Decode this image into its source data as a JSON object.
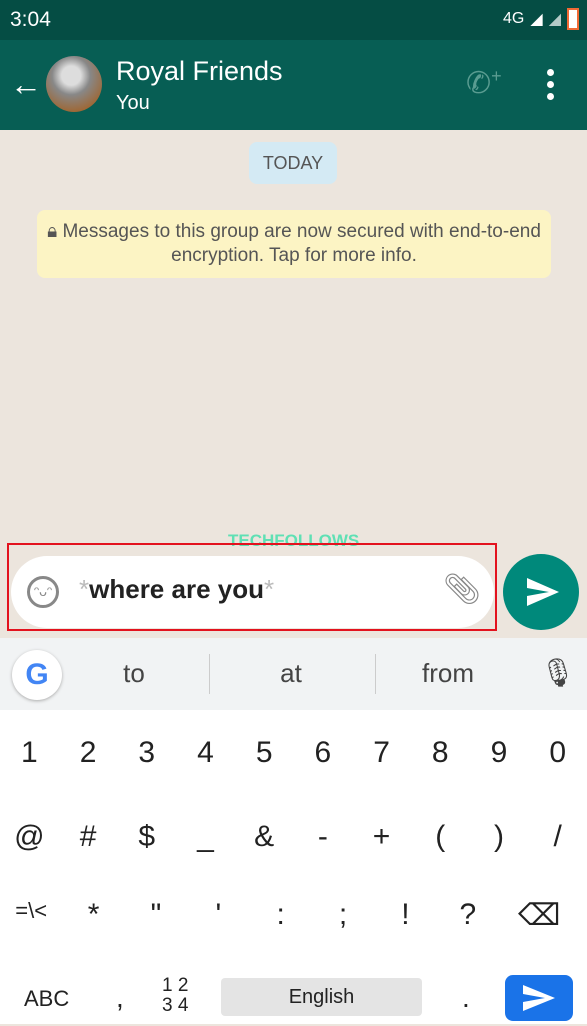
{
  "status": {
    "time": "3:04",
    "network": "4G"
  },
  "header": {
    "title": "Royal Friends",
    "subtitle": "You"
  },
  "chat": {
    "date_chip": "TODAY",
    "encryption_notice": "Messages to this group are now secured with end-to-end encryption. Tap for more info.",
    "watermark": "TECHFOLLOWS"
  },
  "composer": {
    "prefix": "*",
    "text": "where are you",
    "suffix": "*"
  },
  "keyboard": {
    "suggestions": [
      "to",
      "at",
      "from"
    ],
    "row1": [
      "1",
      "2",
      "3",
      "4",
      "5",
      "6",
      "7",
      "8",
      "9",
      "0"
    ],
    "row2": [
      "@",
      "#",
      "$",
      "_",
      "&",
      "-",
      "+",
      "(",
      ")",
      "/"
    ],
    "row3": [
      "=\\<",
      "*",
      "\"",
      "'",
      ":",
      ";",
      "!",
      "?"
    ],
    "abc": "ABC",
    "comma": ",",
    "num_top": "1 2",
    "num_bottom": "3 4",
    "space": "English",
    "period": "."
  },
  "colors": {
    "header": "#075e54",
    "status": "#054d44",
    "send": "#00897b",
    "enter": "#1a73e8",
    "highlight": "#e3121e"
  }
}
